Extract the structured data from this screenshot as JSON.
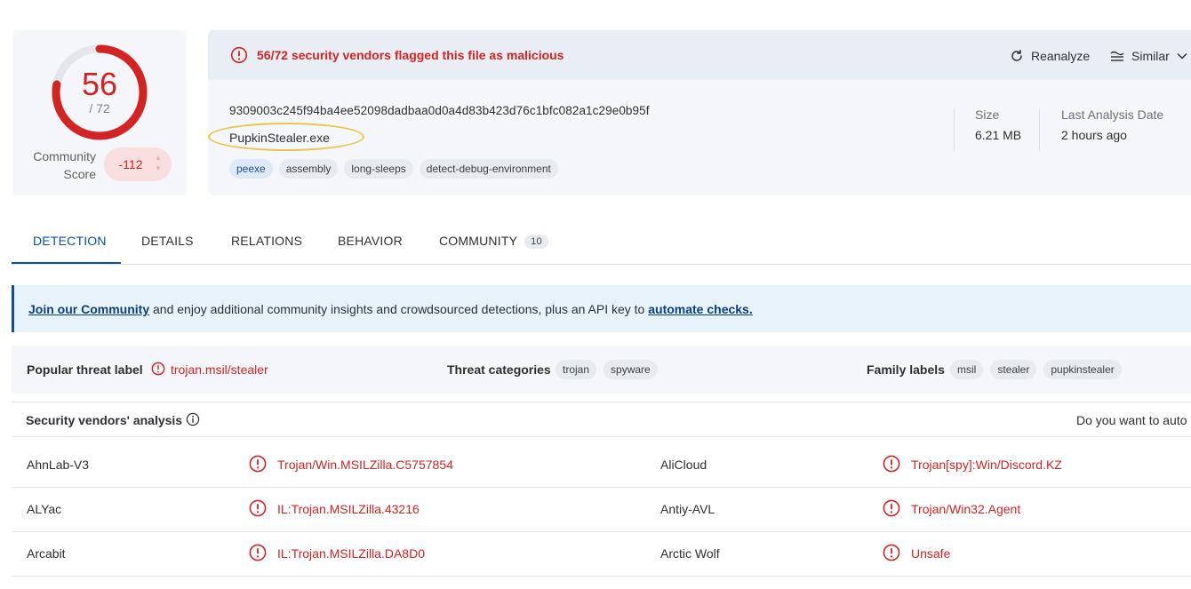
{
  "score": {
    "detections": "56",
    "total": "/ 72",
    "detection_fraction": 0.778,
    "community_label_line1": "Community",
    "community_label_line2": "Score",
    "community_value": "-112"
  },
  "header": {
    "alert": "56/72 security vendors flagged this file as malicious",
    "reanalyze_label": "Reanalyze",
    "similar_label": "Similar",
    "hash": "9309003c245f94ba4ee52098dadbaa0d0a4d83b423d76c1bfc082a1c29e0b95f",
    "filename": "PupkinStealer.exe",
    "tags": [
      "peexe",
      "assembly",
      "long-sleeps",
      "detect-debug-environment"
    ],
    "size_label": "Size",
    "size_value": "6.21 MB",
    "last_analysis_label": "Last Analysis Date",
    "last_analysis_value": "2 hours ago"
  },
  "tabs": [
    {
      "label": "DETECTION"
    },
    {
      "label": "DETAILS"
    },
    {
      "label": "RELATIONS"
    },
    {
      "label": "BEHAVIOR"
    },
    {
      "label": "COMMUNITY",
      "count": "10"
    }
  ],
  "banner": {
    "link1": "Join our Community",
    "middle": " and enjoy additional community insights and crowdsourced detections, plus an API key to ",
    "link2": "automate checks."
  },
  "threat": {
    "popular_label": "Popular threat label",
    "popular_value": "trojan.msil/stealer",
    "categories_label": "Threat categories",
    "categories": [
      "trojan",
      "spyware"
    ],
    "family_label": "Family labels",
    "families": [
      "msil",
      "stealer",
      "pupkinstealer"
    ]
  },
  "vendors": {
    "title": "Security vendors' analysis",
    "right_text": "Do you want to auto",
    "rows": [
      {
        "left_name": "AhnLab-V3",
        "left_result": "Trojan/Win.MSILZilla.C5757854",
        "right_name": "AliCloud",
        "right_result": "Trojan[spy]:Win/Discord.KZ"
      },
      {
        "left_name": "ALYac",
        "left_result": "IL:Trojan.MSILZilla.43216",
        "right_name": "Antiy-AVL",
        "right_result": "Trojan/Win32.Agent"
      },
      {
        "left_name": "Arcabit",
        "left_result": "IL:Trojan.MSILZilla.DA8D0",
        "right_name": "Arctic Wolf",
        "right_result": "Unsafe"
      }
    ]
  },
  "colors": {
    "malicious": "#d32323",
    "accent": "#0b4ea2",
    "panel": "#f4f6fa",
    "highlight_ring": "#e7c64a"
  }
}
